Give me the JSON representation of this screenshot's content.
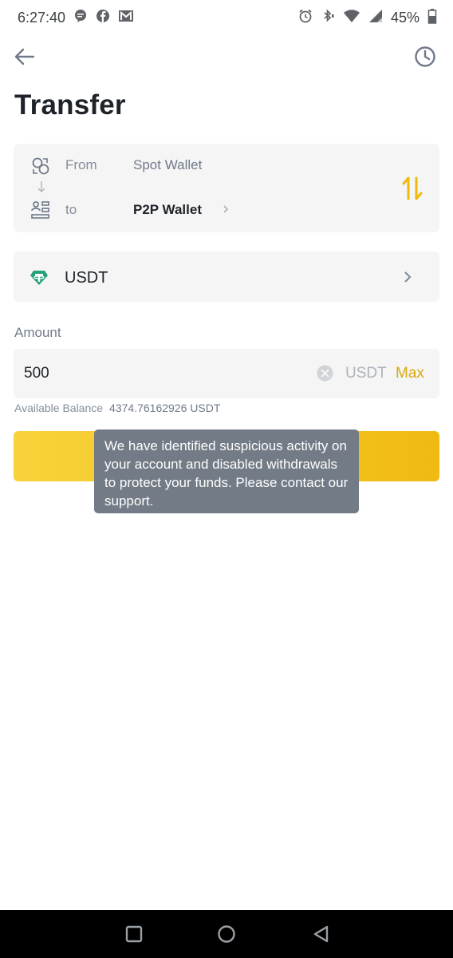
{
  "status_bar": {
    "time": "6:27:40",
    "battery": "45%",
    "icons": [
      "chat-bubble-icon",
      "facebook-icon",
      "gmail-icon",
      "alarm-icon",
      "bluetooth-icon",
      "wifi-icon",
      "signal-icon",
      "battery-icon"
    ]
  },
  "header": {
    "title": "Transfer",
    "icons": [
      "back-arrow-icon",
      "history-clock-icon"
    ]
  },
  "wallets": {
    "from_label": "From",
    "from_value": "Spot Wallet",
    "to_label": "to",
    "to_value": "P2P Wallet",
    "icons": [
      "spot-wallet-icon",
      "p2p-wallet-icon",
      "swap-arrows-icon"
    ]
  },
  "coin": {
    "name": "USDT",
    "icon": "tether-icon",
    "icon_color": "#26a17b"
  },
  "amount": {
    "label": "Amount",
    "value": "500",
    "unit": "USDT",
    "max_label": "Max"
  },
  "balance": {
    "label": "Available Balance",
    "value": "4374.76162926 USDT"
  },
  "toast": {
    "message": "We have identified suspicious activity on your account and disabled withdrawals to protect your funds. Please contact our support."
  },
  "colors": {
    "accent": "#f0b90b",
    "button_start": "#f8d33a",
    "button_end": "#f0ba12",
    "toast_bg": "#737b86",
    "field_bg": "#f5f5f5"
  },
  "nav_bar": {
    "icons": [
      "recents-square-icon",
      "home-circle-icon",
      "back-triangle-icon"
    ]
  }
}
